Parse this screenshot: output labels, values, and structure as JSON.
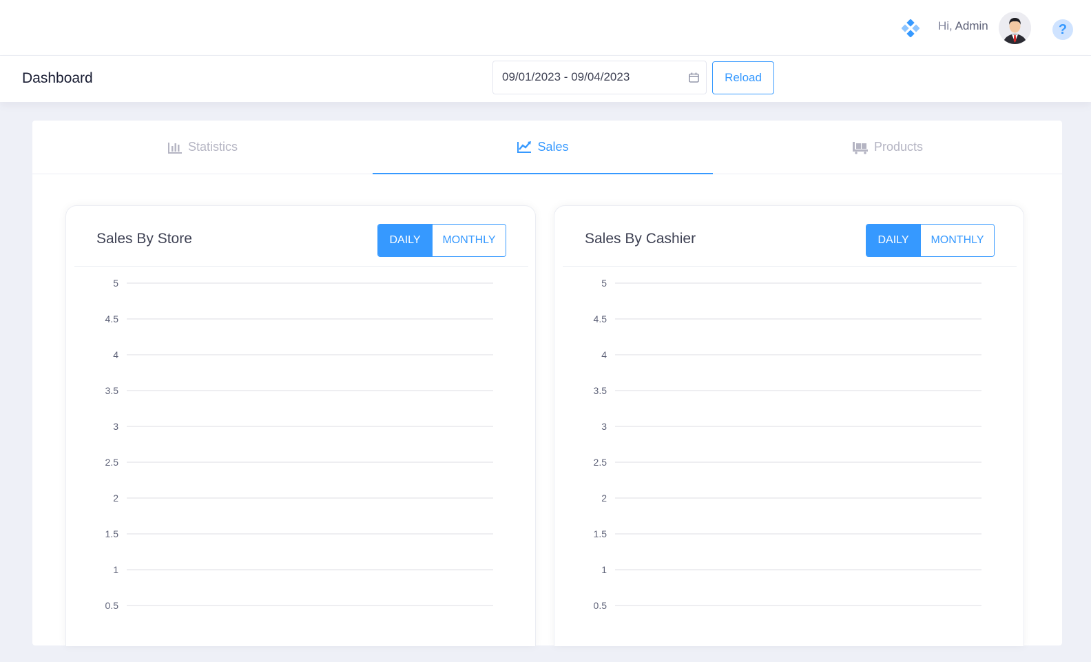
{
  "header": {
    "greeting_prefix": "Hi,",
    "user_name": "Admin",
    "help_glyph": "?"
  },
  "subheader": {
    "page_title": "Dashboard",
    "date_range": "09/01/2023 - 09/04/2023",
    "reload_label": "Reload"
  },
  "tabs": [
    {
      "label": "Statistics",
      "icon": "bar-chart-icon",
      "active": false
    },
    {
      "label": "Sales",
      "icon": "line-chart-icon",
      "active": true
    },
    {
      "label": "Products",
      "icon": "pallet-icon",
      "active": false
    }
  ],
  "panels": [
    {
      "title": "Sales By Store",
      "daily_label": "DAILY",
      "monthly_label": "MONTHLY"
    },
    {
      "title": "Sales By Cashier",
      "daily_label": "DAILY",
      "monthly_label": "MONTHLY"
    }
  ],
  "colors": {
    "accent": "#3699ff",
    "muted": "#b5b5c3",
    "grid": "#dcdde3"
  },
  "chart_data": [
    {
      "type": "bar",
      "title": "Sales By Store",
      "xlabel": "",
      "ylabel": "",
      "ylim": [
        0,
        5
      ],
      "y_ticks": [
        "5",
        "4.5",
        "4",
        "3.5",
        "3",
        "2.5",
        "2",
        "1.5",
        "1",
        "0.5"
      ],
      "series": [],
      "grid": true
    },
    {
      "type": "bar",
      "title": "Sales By Cashier",
      "xlabel": "",
      "ylabel": "",
      "ylim": [
        0,
        5
      ],
      "y_ticks": [
        "5",
        "4.5",
        "4",
        "3.5",
        "3",
        "2.5",
        "2",
        "1.5",
        "1",
        "0.5"
      ],
      "series": [],
      "grid": true
    }
  ]
}
